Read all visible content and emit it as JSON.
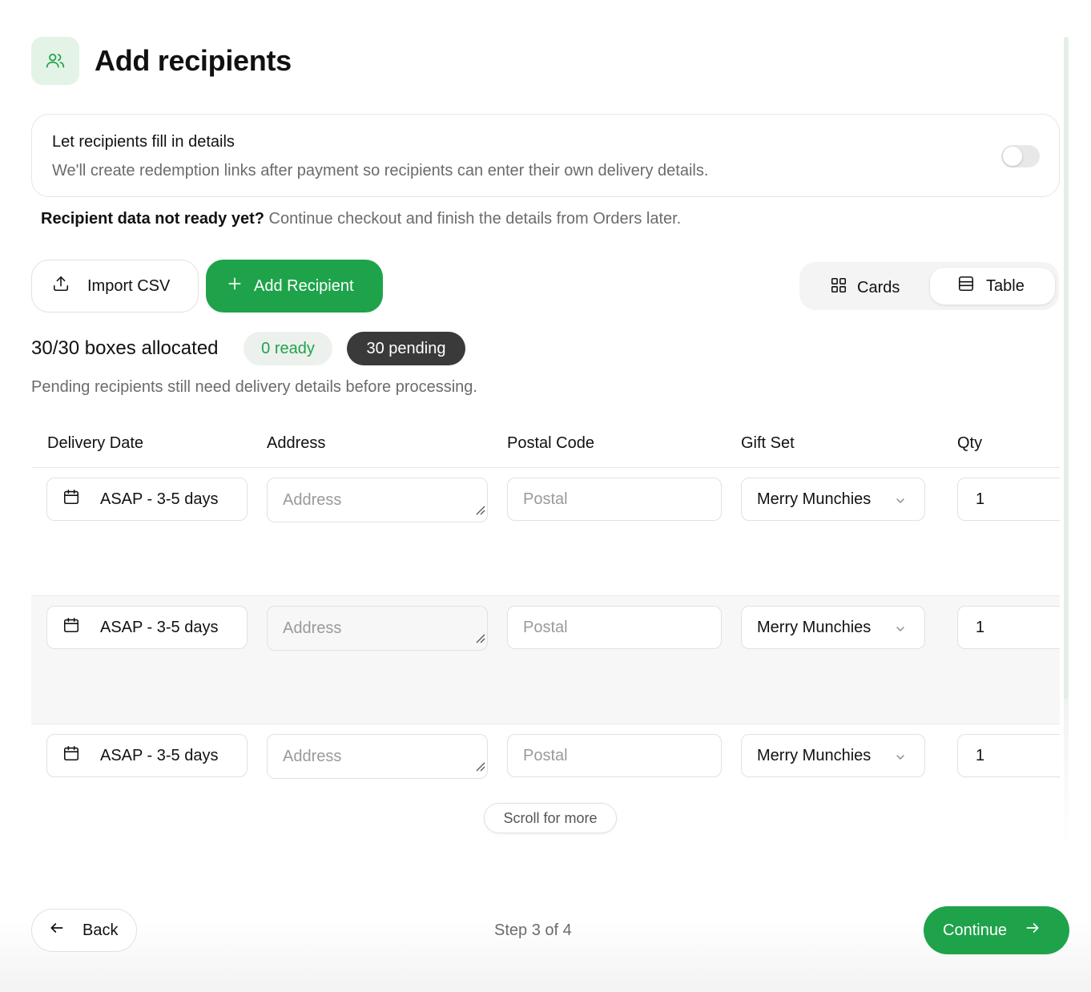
{
  "header": {
    "title": "Add recipients",
    "icon": "users-icon"
  },
  "fill_in": {
    "title": "Let recipients fill in details",
    "description": "We'll create redemption links after payment so recipients can enter their own delivery details.",
    "toggle_on": false
  },
  "note": {
    "strong": "Recipient data not ready yet?",
    "rest": " Continue checkout and finish the details from Orders later."
  },
  "actions": {
    "import_label": "Import CSV",
    "add_label": "Add Recipient"
  },
  "view": {
    "cards_label": "Cards",
    "table_label": "Table",
    "selected": "Table"
  },
  "allocation": {
    "text": "30/30 boxes allocated",
    "ready": "0 ready",
    "pending": "30 pending",
    "note": "Pending recipients still need delivery details before processing."
  },
  "table": {
    "headers": [
      "Delivery Date",
      "Address",
      "Postal Code",
      "Gift Set",
      "Qty"
    ],
    "rows": [
      {
        "date": "ASAP - 3-5 days",
        "address_placeholder": "Address",
        "postal_placeholder": "Postal",
        "gift_set": "Merry Munchies",
        "qty": "1"
      },
      {
        "date": "ASAP - 3-5 days",
        "address_placeholder": "Address",
        "postal_placeholder": "Postal",
        "gift_set": "Merry Munchies",
        "qty": "1"
      },
      {
        "date": "ASAP - 3-5 days",
        "address_placeholder": "Address",
        "postal_placeholder": "Postal",
        "gift_set": "Merry Munchies",
        "qty": "1"
      }
    ]
  },
  "scroll_hint": "Scroll for more",
  "footer": {
    "back_label": "Back",
    "step": "Step 3 of 4",
    "continue_label": "Continue"
  },
  "colors": {
    "accent": "#1fa34a",
    "accent_soft": "#e3f3e6",
    "pending_pill": "#3a3a3a"
  }
}
